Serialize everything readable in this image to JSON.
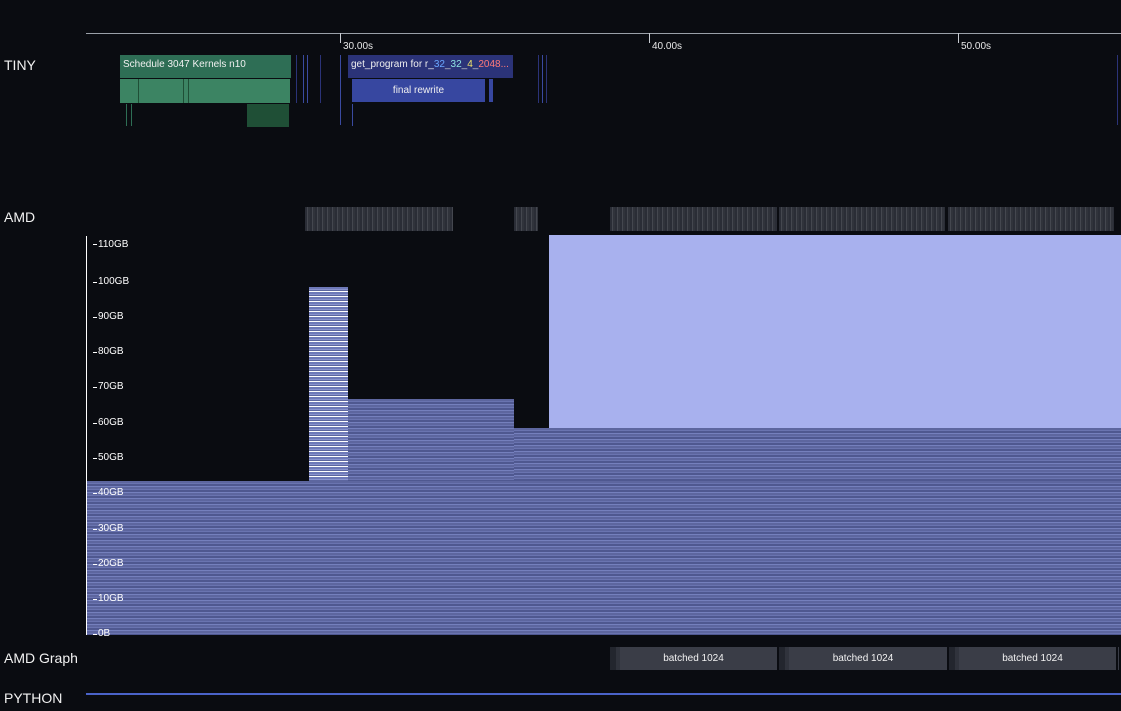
{
  "timeline": {
    "ticks": [
      "30.00s",
      "40.00s",
      "50.00s"
    ]
  },
  "lanes": {
    "tiny": {
      "label": "TINY",
      "schedule_label": "Schedule 3047 Kernels n10",
      "get_program_prefix": "get_program for r_",
      "get_program_parts": [
        "32",
        "_",
        "32",
        "_",
        "4",
        "_",
        "2048..."
      ],
      "get_program_colors": [
        "#6aa7ff",
        "#cccccc",
        "#8fe3e3",
        "#cccccc",
        "#f0e36a",
        "#cccccc",
        "#ff7a7a"
      ],
      "final_rewrite_label": "final rewrite"
    },
    "amd": {
      "label": "AMD"
    },
    "memory": {
      "y_ticks": [
        "110GB",
        "100GB",
        "90GB",
        "80GB",
        "70GB",
        "60GB",
        "50GB",
        "40GB",
        "30GB",
        "20GB",
        "10GB",
        "0B"
      ],
      "fill_color": "#a8b1ee",
      "stripe_color": "#5d669f"
    },
    "amd_graph": {
      "label": "AMD Graph",
      "blocks": [
        "batched 1024",
        "batched 1024",
        "batched 1024"
      ]
    },
    "python": {
      "label": "PYTHON",
      "line_color": "#4a63c9"
    }
  }
}
